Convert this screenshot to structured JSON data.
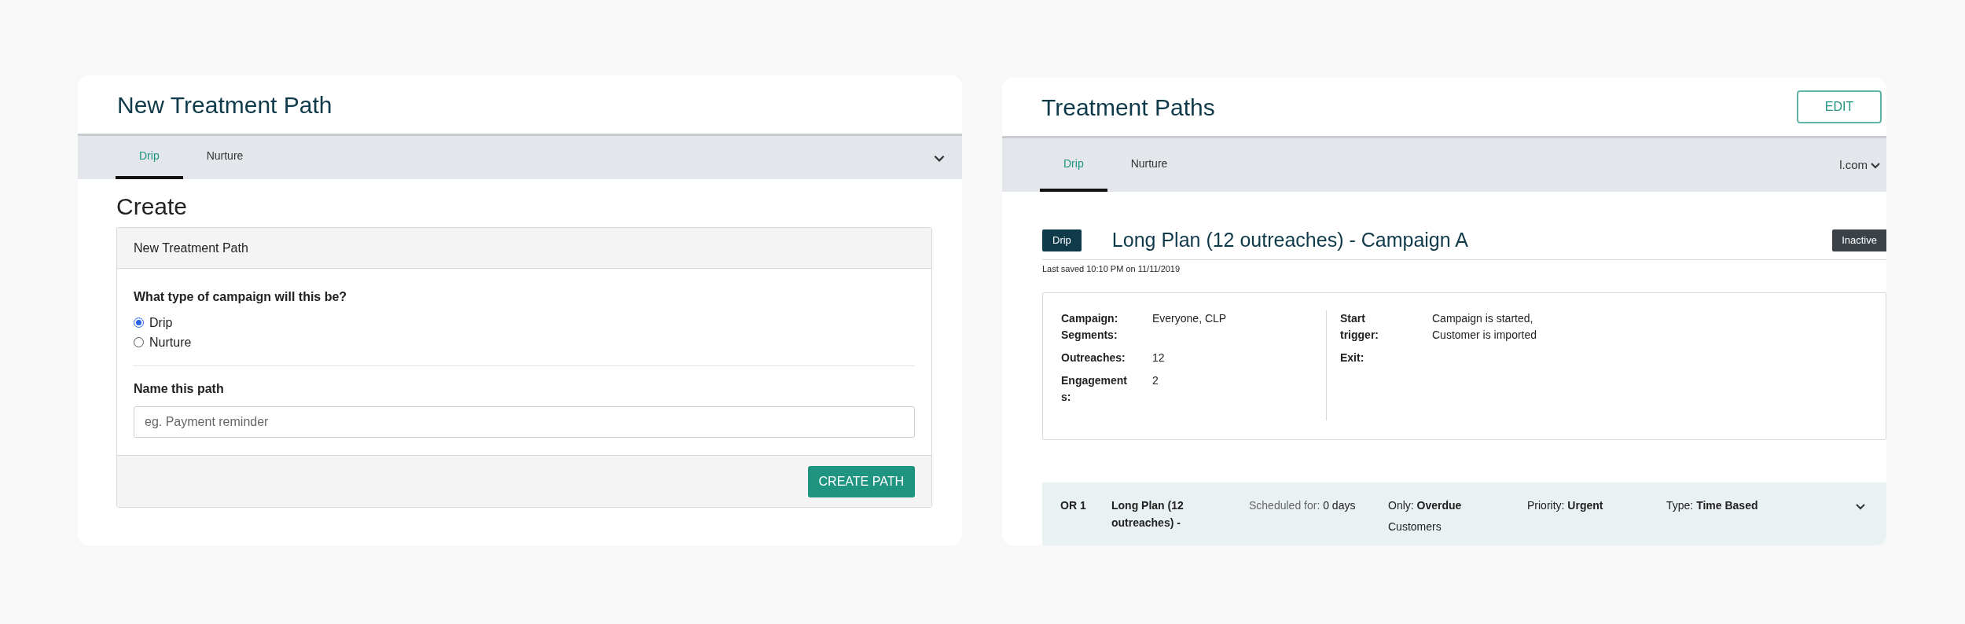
{
  "create_card": {
    "title": "New Treatment Path",
    "tabs": [
      {
        "label": "Drip",
        "selected": true
      },
      {
        "label": "Nurture",
        "selected": false
      }
    ],
    "heading": "Create",
    "panel": {
      "header": "New Treatment Path",
      "question": "What type of campaign will this be?",
      "options": [
        {
          "label": "Drip",
          "selected": true
        },
        {
          "label": "Nurture",
          "selected": false
        }
      ],
      "name_label": "Name this path",
      "name_field": {
        "placeholder": "eg. Payment reminder"
      },
      "button": "CREATE PATH"
    }
  },
  "paths_card": {
    "title": "Treatment Paths",
    "edit_button": "EDIT",
    "tabs": [
      {
        "label": "Drip",
        "selected": true
      },
      {
        "label": "Nurture",
        "selected": false
      }
    ],
    "account_menu": "l.com",
    "path": {
      "type_badge": "Drip",
      "title": "Long Plan (12 outreaches) - Campaign A",
      "status": "Inactive",
      "last_saved": "Last saved 10:10 PM on 11/11/2019",
      "details_left": [
        {
          "label": "Campaign: Segments:",
          "value": "Everyone, CLP"
        },
        {
          "label": "Outreaches:",
          "value": "12"
        },
        {
          "label": "Engagements:",
          "value": "2"
        }
      ],
      "details_right": [
        {
          "label": "Start trigger:",
          "value": "Campaign is started, Customer is imported"
        },
        {
          "label": "Exit:"
        }
      ]
    },
    "outreaches": [
      {
        "id": "OR 1",
        "name": "Long Plan (12 outreaches) -",
        "scheduled_label": "Scheduled for:",
        "scheduled": "0 days",
        "only_label": "Only:",
        "only": "Overdue",
        "only_extra": "Customers",
        "priority_label": "Priority:",
        "priority": "Urgent",
        "type_label": "Type:",
        "type": "Time Based",
        "expanded": false
      }
    ]
  }
}
